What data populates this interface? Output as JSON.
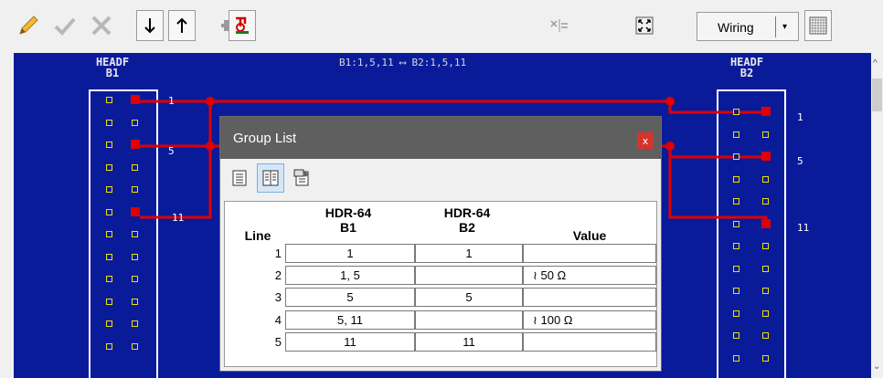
{
  "toolbar": {
    "buttons": [
      "pencil-icon",
      "check-icon",
      "close-icon",
      "arrow-down-icon",
      "arrow-up-icon",
      "plug-icon",
      "probe-icon",
      "split-icon",
      "fit-icon",
      "grid-icon"
    ],
    "wiring_select": {
      "value": "Wiring"
    }
  },
  "canvas": {
    "header_left": {
      "line1": "HEADF",
      "line2": "B1"
    },
    "header_right": {
      "line1": "HEADF",
      "line2": "B2"
    },
    "bus_label": "B1:1,5,11 ⟷ B2:1,5,11",
    "left_labels": [
      "1",
      "5",
      "11"
    ],
    "right_labels": [
      "1",
      "5",
      "11"
    ],
    "wire_color": "#e00000",
    "background_color": "#0a1b9a"
  },
  "dialog": {
    "title": "Group List",
    "close": "x",
    "tools": [
      "list-view-icon",
      "columns-view-icon",
      "properties-icon"
    ],
    "columns": {
      "line": "Line",
      "b1_top": "HDR-64",
      "b1_bottom": "B1",
      "b2_top": "HDR-64",
      "b2_bottom": "B2",
      "value": "Value"
    },
    "rows": [
      {
        "line": "1",
        "b1": "1",
        "b2": "1",
        "value": ""
      },
      {
        "line": "2",
        "b1": "1, 5",
        "b2": "",
        "value": "≀ 50 Ω"
      },
      {
        "line": "3",
        "b1": "5",
        "b2": "5",
        "value": ""
      },
      {
        "line": "4",
        "b1": "5, 11",
        "b2": "",
        "value": "≀ 100 Ω"
      },
      {
        "line": "5",
        "b1": "11",
        "b2": "11",
        "value": ""
      }
    ]
  }
}
